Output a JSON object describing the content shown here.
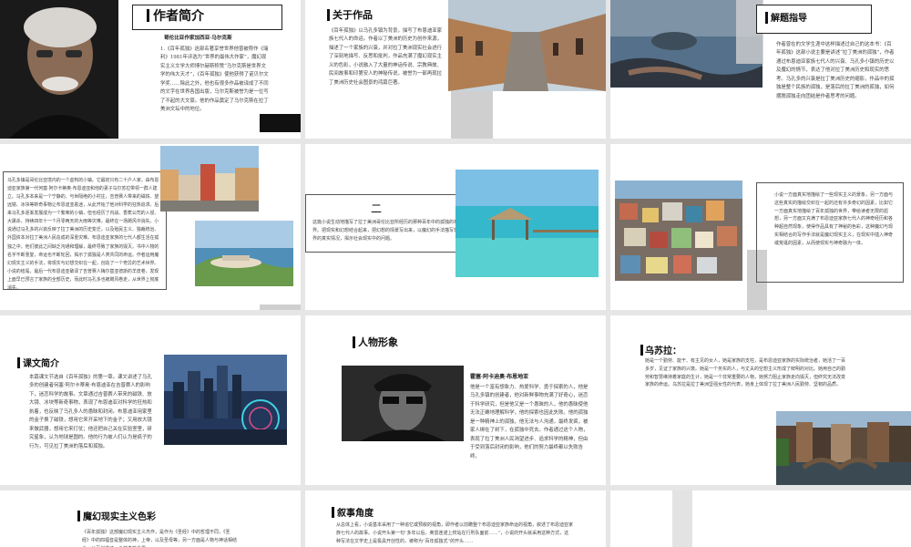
{
  "slide1": {
    "title": "作者简介",
    "subtitle": "哥伦比亚作家加西亚·马尔克斯",
    "body": "1.《百年孤独》这部名著享誉世界他曾被称作《瑞利》1981年评选为“世界的最伟大作家”，魔幻现实主义文学大师博尔赫斯称赞“马尔克斯是世界文学的伟大天才”，《百年孤独》使他获得了诺贝尔文学奖……除此之外，他也有很多作品被译成了不同的文字在世界各国出版，马尔克斯被誉为是一位写了不起的大文豪。他的作品奠定了马尔克斯在拉丁美洲文坛中的地位。"
  },
  "slide2": {
    "title": "关于作品",
    "body": "《百年孤独》以马孔多镇为背景，描写了布恩迪亚家族七代人的命运。作者以丁美洲的历史为创作来源，描述了一个家族的兴衰，并对拉丁美洲现实社会进行了深刻地描写、反思和批判，作品充满了魔幻现实主义的色彩，小说融入了大量的神话传说、宗教典故、民间故事和印第安人的神秘传说，被誉为一部再现拉丁美洲历史社会图景的鸿篇巨著。"
  },
  "slide3": {
    "title": "解题指导",
    "body": "作者曾在的文学生涯中这样描述过自己的这本书：《百年孤独》这部小说主要是讲述“拉丁美洲的孤独”，作者通过布恩迪亚家族七代人的兴衰、马孔多小镇的历史以及魔幻的情节，表达了他对拉丁美洲历史和现实的思考。马孔多的兴衰是拉丁美洲历史的缩影，作品中的孤独是整个民族的孤独，是落后的拉丁美洲的孤独，如何摆脱孤独走向团结是作者思考的问题。"
  },
  "slide4": {
    "body": "马孔多镇是哥伦比亚境内的一个虚构的小镇。它最初只有二十户人家，由布恩迪亚家族第一代何塞·阿尔卡蒂奥·布恩迪亚和他的妻子乌尔苏拉带领一群人建立。马孔多本来是一个宁静的、与世隔绝的小村庄，吉普赛人带来的磁铁、望远镜、冰块等新奇事物让布恩迪亚着迷，从此开始了他对科学的狂热追求。后来马孔多逐渐发展成为一个繁荣的小镇，但也经历了内战、香蕉公司的入侵、大屠杀、持续四年十一个月零两天的大雨等灾难，最终在一场飓风中消失。小说通过马孔多的兴衰反映了拉丁美洲的历史变迁，以及殖民主义、独裁统治、外国资本对拉丁美洲人民造成的深重灾难。布恩迪亚家族的七代人都生活在孤独之中，他们彼此之间缺乏沟通和理解，最终导致了家族的毁灭。书中人物的名字不断重复，命运也不断轮回，揭示了孤独是人类共同的命运。作者运用魔幻现实主义的手法，将现实与幻想交织在一起，创造了一个奇异的艺术世界。小说的结尾，最后一代布恩迪亚破译了吉普赛人梅尔基亚德斯的羊皮卷，发现上面早已预言了家族的全部历史，而此时马孔多也被飓风卷走，从世界上彻底消失。"
  },
  "slide5": {
    "title": "二",
    "body": "这篇小说生动地描写了拉丁美洲哥伦比亚所经历的那种百年中的孤独的神秘世界。把现实和幻想结合起来，把幻想的情景写出来，以魔幻的手法描写现实世界的真实情况，揭示社会现实中的问题。"
  },
  "slide6": {
    "body": "小说一方面真实地描绘了一些现实主义的景象，另一方面与这些真实的描绘交织在一起的还有许多奇幻的因素，比如它一方面真实地描绘了百年孤独的世界，带给读者无限的遐想，另一方面又充满了布恩迪亚家族七代人的神奇经历和各种超自然现象，使得作品具有了神秘的色彩，这种魔幻与现实相结合的写作手法就是魔幻现实主义，在现实中插入神奇或荒诞的因素，从而使现实与神奇融为一体。"
  },
  "slide7": {
    "title": "课文简介",
    "body": "本篇课文节选自《百年孤独》的第一章。课文讲述了马孔多的创建者何塞·阿尔卡蒂奥·布恩迪亚在吉普赛人的影响下，迷恋科学的故事。文章通过吉普赛人带来的磁铁、放大镜、冰块等新奇事物，表现了布恩迪亚对科学的狂热和执着，也反映了马孔多人的愚昧和封闭。布恩迪亚用家里的金子换了磁铁，想用它来开采地下的金子；又用放大镜来做武器，想用它来打仗；他还把自己关在实验室里，研究星象，认为地球是圆的。他的行为被人们认为是疯子的行为，可见拉丁美洲的落后和孤独。"
  },
  "slide8": {
    "title": "人物形象",
    "name": "霍塞·阿卡迪奥·布恩地亚",
    "body": "他是一个富有想象力、热爱科学、勇于探索的人，他是马孔多镇的创建者，他对新鲜事物充满了好奇心，迷恋于科学研究，但是他又是一个愚昧的人，他的愚昧使他无法正确地理解科学，他的探索也因此失败。他的孤独是一种精神上的孤独，他无法与人沟通，最终发疯，被家人绑在了树下，在孤独中死去。作者通过这个人物，表现了拉丁美洲人民渴望进步、追求科学的精神，但由于受到落后封闭的影响，他们的努力最终都以失败告终。"
  },
  "slide9": {
    "title": "乌苏拉：",
    "body": "她是一个勤劳、能干、有主见的女人，她是家族的支柱，是布恩迪亚家族的实际统治者，她活了一百多岁，见证了家族的兴衰。她是一个务实的人，与丈夫的空想主义形成了鲜明的对比。她用自己的勤劳和智慧维持着家庭的生计，她是一个非常重要的人物，她努力阻止家族走向毁灭，但终究无法改变家族的命运。乌苏拉是拉丁美洲坚强女性的代表，她身上体现了拉丁美洲人民勤劳、坚韧的品质。"
  },
  "slide10": {
    "title": "魔幻现实主义色彩",
    "body": "《百年孤独》这部魔幻现实主义杰作，是作为《圣经》中的哲理不同，《圣经》中的四福音是整体的神，上帝，以及圣母等，另一方面是人物与神话相结合，从而创造了一个神奇的世界……"
  },
  "slide11": {
    "title": "叙事角度",
    "body": "从总体上看，小说基本采用了一种追忆或预叙的视角，即作者以前瞻整个布恩迪亚家族命运的视角，叙述了布恩迪亚家族七代人的故事。小说开头第一句“多年以后，奥雷连诺上校站在行刑队面前……”，小说的开头就采用这种方式，这种写法在文学史上是极具开创性的，被称为“百年孤独式”的开头……"
  }
}
